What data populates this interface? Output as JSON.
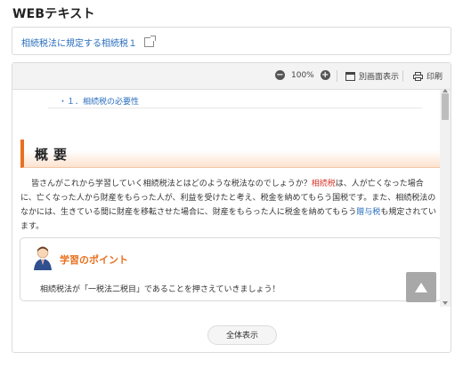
{
  "page": {
    "title": "WEBテキスト"
  },
  "link": {
    "label": "相続税法に規定する相続税１"
  },
  "toolbar": {
    "zoom_out": "−",
    "zoom": "100%",
    "zoom_in": "+",
    "popout_label": "別画面表示",
    "print_label": "印刷"
  },
  "doc": {
    "toc_item": "・１．相続税の必要性",
    "section_title": "概要",
    "para": {
      "p1": "皆さんがこれから学習していく相続税法とはどのような税法なのでしょうか？",
      "k1": "相続税",
      "p2": "は、人が亡くなった場合に、亡くなった人から財産をもらった人が、利益を受けたと考え、税金を納めてもらう国税です。また、相続税法のなかには、生きている間に財産を移転させた場合に、財産をもらった人に税金を納めてもらう",
      "k2": "贈与税",
      "p3": "も規定されています。"
    },
    "point": {
      "title": "学習のポイント",
      "text": "相続税法が「一税法二税目」であることを押さえていきましょう！"
    }
  },
  "buttons": {
    "full_view": "全体表示"
  },
  "colors": {
    "accent": "#e8701f",
    "link": "#2a6fbf",
    "keyword": "#d9372c"
  }
}
